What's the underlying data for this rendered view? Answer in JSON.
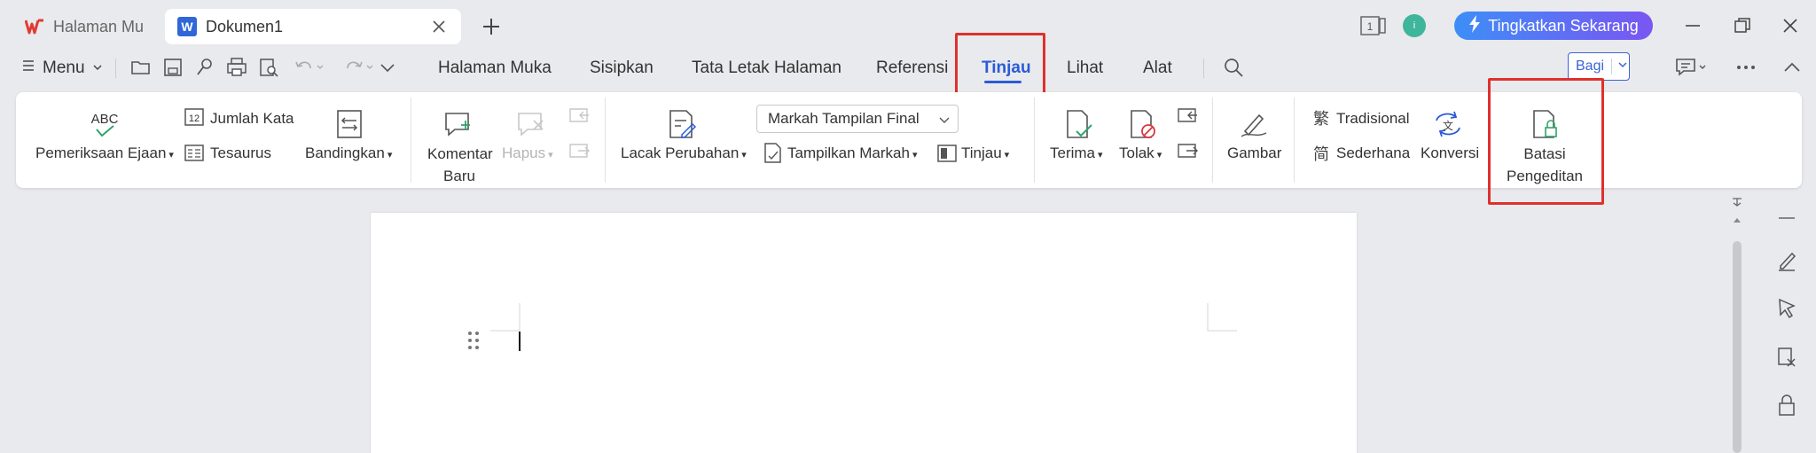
{
  "titlebar": {
    "home_tab": "Halaman Mu",
    "doc_tab": "Dokumen1",
    "page_indicator": "1",
    "avatar": "i",
    "upgrade_label": "Tingkatkan Sekarang"
  },
  "menubar": {
    "menu_label": "Menu",
    "tabs": [
      "Halaman Muka",
      "Sisipkan",
      "Tata Letak Halaman",
      "Referensi",
      "Tinjau",
      "Lihat",
      "Alat"
    ],
    "active_tab": "Tinjau",
    "share_label": "Bagi"
  },
  "ribbon": {
    "spelling": "Pemeriksaan Ejaan",
    "word_count": "Jumlah Kata",
    "thesaurus": "Tesaurus",
    "compare": "Bandingkan",
    "new_comment_line1": "Komentar",
    "new_comment_line2": "Baru",
    "delete": "Hapus",
    "track_changes": "Lacak Perubahan",
    "markup_select": "Markah Tampilan Final",
    "show_markup": "Tampilkan Markah",
    "review": "Tinjau",
    "accept": "Terima",
    "reject": "Tolak",
    "ink": "Gambar",
    "traditional": "Tradisional",
    "simplified": "Sederhana",
    "convert": "Konversi",
    "restrict_line1": "Batasi",
    "restrict_line2": "Pengeditan"
  },
  "colors": {
    "accent": "#2a5bd7",
    "highlight": "#e0302c",
    "upgrade_gradient_start": "#3d8ef7",
    "upgrade_gradient_end": "#7a56f2"
  }
}
